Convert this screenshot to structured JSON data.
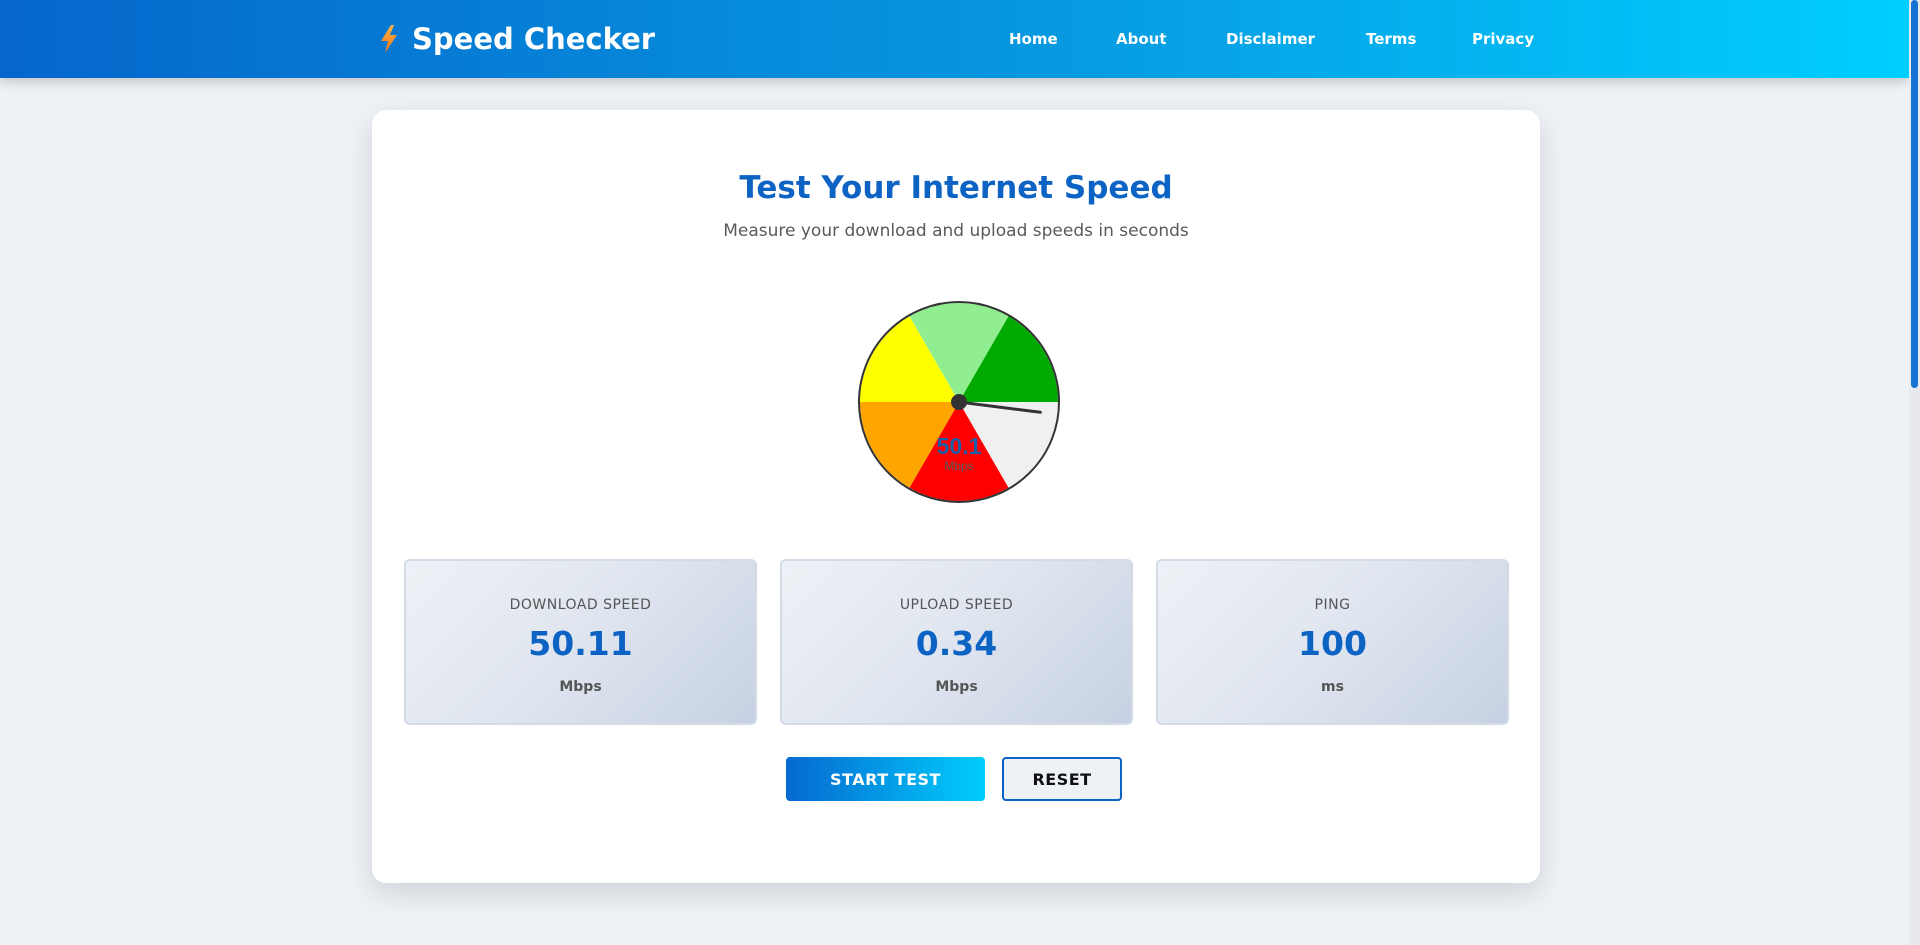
{
  "header": {
    "brand": "Speed Checker",
    "nav": [
      "Home",
      "About",
      "Disclaimer",
      "Terms",
      "Privacy"
    ]
  },
  "main": {
    "title": "Test Your Internet Speed",
    "subtitle": "Measure your download and upload speeds in seconds"
  },
  "gauge": {
    "value_text": "50.1",
    "unit": "Mbps",
    "needle_value_fraction": 0.52,
    "segment_colors": [
      "#ffff00",
      "#90ee90",
      "#00aa00",
      "#f0f0f0",
      "#ff0000",
      "#ffa500"
    ]
  },
  "stats": [
    {
      "label": "DOWNLOAD SPEED",
      "value": "50.11",
      "unit": "Mbps"
    },
    {
      "label": "UPLOAD SPEED",
      "value": "0.34",
      "unit": "Mbps"
    },
    {
      "label": "PING",
      "value": "100",
      "unit": "ms"
    }
  ],
  "buttons": {
    "start": "START TEST",
    "reset": "RESET"
  },
  "colors": {
    "accent": "#0d63c4",
    "header_gradient_start": "#0566cc",
    "header_gradient_end": "#00cfff"
  },
  "icons": {
    "brand": "lightning-bolt-icon"
  }
}
